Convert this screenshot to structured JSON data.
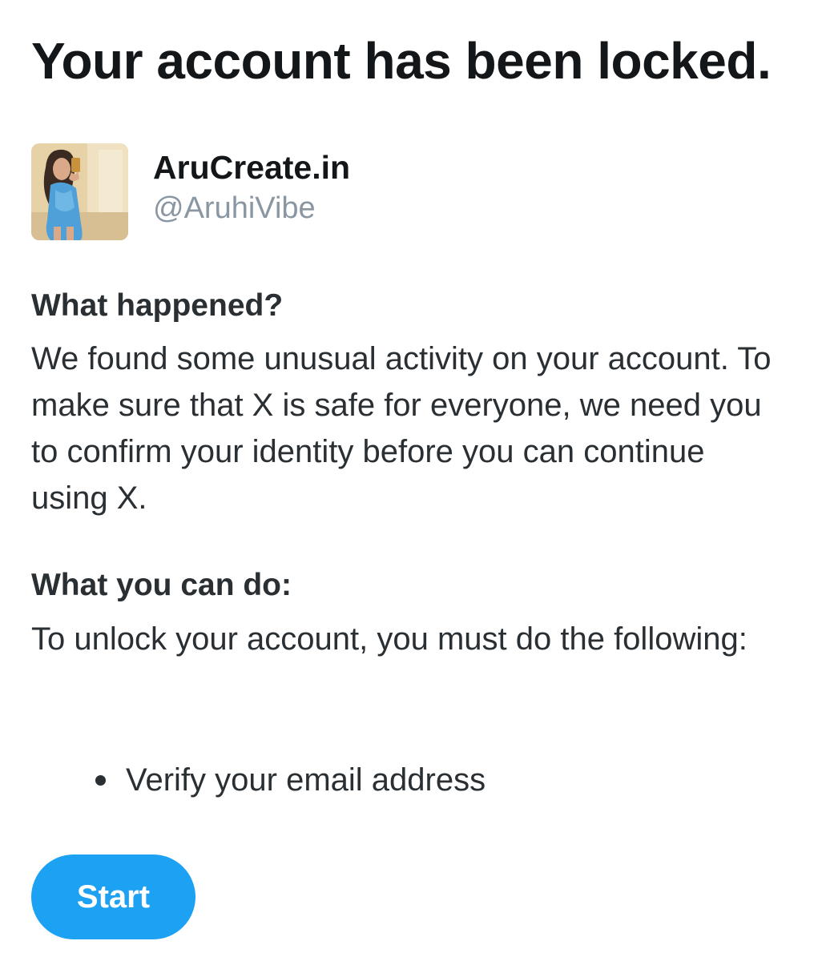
{
  "page": {
    "title": "Your account has been locked."
  },
  "profile": {
    "display_name": "AruCreate.in",
    "handle": "@AruhiVibe",
    "avatar_icon": "profile-photo"
  },
  "sections": [
    {
      "heading": "What happened?",
      "text": "We found some unusual activity on your account. To make sure that X is safe for everyone, we need you to confirm your identity before you can continue using X."
    },
    {
      "heading": "What you can do:",
      "text": "To unlock your account, you must do the following:"
    }
  ],
  "requirements": [
    "Verify your email address"
  ],
  "actions": {
    "start_label": "Start"
  },
  "colors": {
    "accent": "#1da1f2",
    "text": "#14171a",
    "secondary_text": "#8a97a3"
  }
}
